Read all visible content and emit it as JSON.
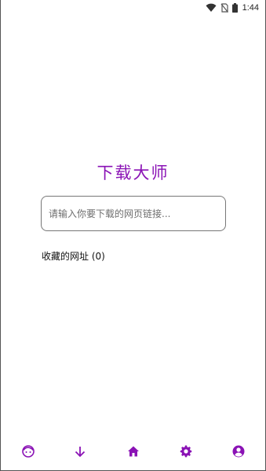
{
  "status_bar": {
    "time": "1:44",
    "icons": [
      "wifi-icon",
      "no-sim-icon",
      "battery-icon"
    ]
  },
  "app": {
    "title": "下载大师"
  },
  "url_input": {
    "placeholder": "请输入你要下载的网页链接...",
    "value": ""
  },
  "bookmarks": {
    "label": "收藏的网址 (0)"
  },
  "bottom_nav": {
    "items": [
      {
        "icon": "face-icon",
        "semantic": "profile-face"
      },
      {
        "icon": "download-arrow-icon",
        "semantic": "downloads"
      },
      {
        "icon": "home-icon",
        "semantic": "home"
      },
      {
        "icon": "gear-icon",
        "semantic": "settings"
      },
      {
        "icon": "account-circle-icon",
        "semantic": "account"
      }
    ],
    "accent_color": "#8a12b5"
  },
  "colors": {
    "accent": "#8a12b5",
    "background": "#ffffff",
    "input_border": "#777777"
  }
}
